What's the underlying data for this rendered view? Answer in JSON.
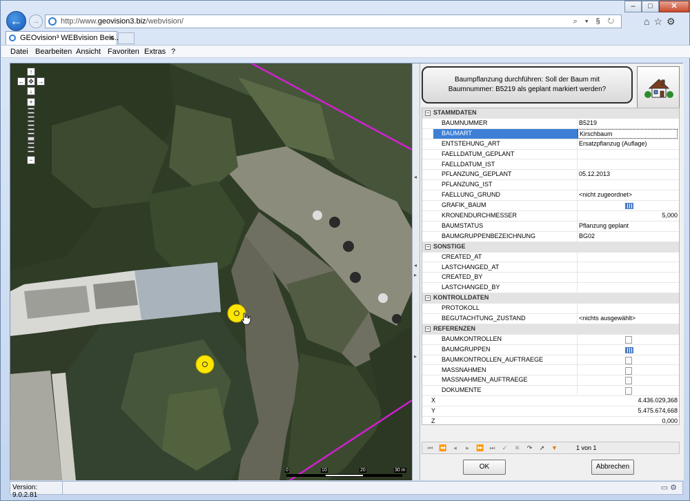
{
  "browser": {
    "url_prefix": "http://www.",
    "url_host": "geovision3.biz",
    "url_path": "/webvision/",
    "url_tools": "⌕ ▾ § ↻",
    "back_label": "←",
    "forward_label": "→",
    "window_controls": {
      "minimize": "–",
      "maximize": "□",
      "close": "✕"
    },
    "right_icons": "⌂☆⚙",
    "tab_title": "GEOvision³ WEBvision Beis...",
    "tab_close": "✕"
  },
  "menu": {
    "items": [
      "Datei",
      "Bearbeiten",
      "Ansicht",
      "Favoriten",
      "Extras",
      "?"
    ]
  },
  "map": {
    "controls": {
      "up": "↑",
      "left": "←",
      "center": "✥",
      "right": "→",
      "down": "↓",
      "zoom_in": "+",
      "zoom_out": "−"
    },
    "scale_labels": [
      "0",
      "10",
      "20",
      "30 m"
    ],
    "markers": [
      {
        "name": "tree-marker-1"
      },
      {
        "name": "tree-marker-2"
      }
    ],
    "line_color": "#d21fd2",
    "marker_color": "#ffe600"
  },
  "panel": {
    "prompt": "Baumpflanzung durchführen: Soll der Baum mit Baumnummer: B5219 als geplant markiert werden?",
    "sections": [
      {
        "title": "STAMMDATEN",
        "rows": [
          {
            "label": "BAUMNUMMER",
            "value": "B5219"
          },
          {
            "label": "BAUMART",
            "value": "Kirschbaum",
            "selected": true
          },
          {
            "label": "ENTSTEHUNG_ART",
            "value": "Ersatzpflanzug (Auflage)"
          },
          {
            "label": "FAELLDATUM_GEPLANT",
            "value": ""
          },
          {
            "label": "FAELLDATUM_IST",
            "value": ""
          },
          {
            "label": "PFLANZUNG_GEPLANT",
            "value": "05.12.2013"
          },
          {
            "label": "PFLANZUNG_IST",
            "value": ""
          },
          {
            "label": "FAELLUNG_GRUND",
            "value": "<nicht zugeordnet>"
          },
          {
            "label": "GRAFIK_BAUM",
            "value": "",
            "icon": "grid"
          },
          {
            "label": "KRONENDURCHMESSER",
            "value": "",
            "value_right": "5,000"
          },
          {
            "label": "BAUMSTATUS",
            "value": "Pflanzung geplant"
          },
          {
            "label": "BAUMGRUPPENBEZEICHNUNG",
            "value": "BG02"
          }
        ]
      },
      {
        "title": "SONSTIGE",
        "rows": [
          {
            "label": "CREATED_AT",
            "value": ""
          },
          {
            "label": "LASTCHANGED_AT",
            "value": ""
          },
          {
            "label": "CREATED_BY",
            "value": ""
          },
          {
            "label": "LASTCHANGED_BY",
            "value": ""
          }
        ]
      },
      {
        "title": "KONTROLLDATEN",
        "rows": [
          {
            "label": "PROTOKOLL",
            "value": ""
          },
          {
            "label": "BEGUTACHTUNG_ZUSTAND",
            "value": "<nichts ausgewählt>"
          }
        ]
      },
      {
        "title": "REFERENZEN",
        "rows": [
          {
            "label": "BAUMKONTROLLEN",
            "value": "",
            "icon": "doc"
          },
          {
            "label": "BAUMGRUPPEN",
            "value": "",
            "icon": "grid"
          },
          {
            "label": "BAUMKONTROLLEN_AUFTRAEGE",
            "value": "",
            "icon": "doc"
          },
          {
            "label": "MASSNAHMEN",
            "value": "",
            "icon": "doc"
          },
          {
            "label": "MASSNAHMEN_AUFTRAEGE",
            "value": "",
            "icon": "doc"
          },
          {
            "label": "DOKUMENTE",
            "value": "",
            "icon": "doc"
          }
        ]
      }
    ],
    "coords": [
      {
        "label": "X",
        "value": "4.436.029,368"
      },
      {
        "label": "Y",
        "value": "5.475.674,668"
      },
      {
        "label": "Z",
        "value": "0,000"
      }
    ],
    "toolbar_buttons": [
      "⏮",
      "⏪",
      "◂",
      "▸",
      "⏩",
      "⏭",
      "✓",
      "✕",
      "↷",
      "➚",
      "▼"
    ],
    "pager": "1 von 1",
    "ok_label": "OK",
    "cancel_label": "Abbrechen",
    "collapse_glyph": "−"
  },
  "status": {
    "version": "Version: 9.0.2.81",
    "icons": "▭ ⚙"
  }
}
